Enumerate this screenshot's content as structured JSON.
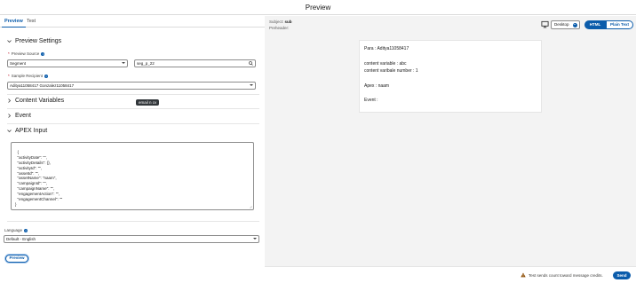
{
  "header": {
    "title": "Preview"
  },
  "tabs": [
    {
      "label": "Preview"
    },
    {
      "label": "Test"
    }
  ],
  "preview_settings": {
    "heading": "Preview Settings",
    "preview_source_label": "Preview Source",
    "preview_source_value": "Segment",
    "segment_search_value": "seg_p_22",
    "sample_recipient_label": "Sample Recipient",
    "sample_recipient_value": "Aditya11058417 Gonzalez11058417"
  },
  "sections": {
    "content_variables": "Content Variables",
    "event": "Event",
    "apex_input": "APEX Input"
  },
  "tooltip": "email n cv",
  "apex_text": "{\n  \"activityDate\": \"\",\n  \"activityDetails\": {},\n  \"activityId\": \"\",\n  \"assetId\": \"\",\n  \"assetName\": \"naam\",\n  \"campaignId\": \"\",\n  \"campaignName\": \"\",\n  \"engagementAction\": \"\",\n  \"engagementChannel\": \"\"\n}",
  "language": {
    "label": "Language",
    "value": "Default - English"
  },
  "preview_button": "Preview",
  "meta": {
    "subject_label": "Subject:",
    "subject_value": "sub",
    "preheader_label": "Preheader:"
  },
  "device_select": "Desktop",
  "format_toggle": {
    "html": "HTML",
    "plain": "Plain Text"
  },
  "email_preview": {
    "line1": "Para : Aditya11058417",
    "line2": "content variable : abc",
    "line3": "content varibale number : 1",
    "line4": "Apex : naam",
    "line5": "Event :"
  },
  "footer": {
    "credits_note": "Test sends count toward message credits.",
    "send_button": "Send"
  },
  "colors": {
    "brand": "#0b5cab",
    "preview_bg": "#f3f3f3"
  }
}
